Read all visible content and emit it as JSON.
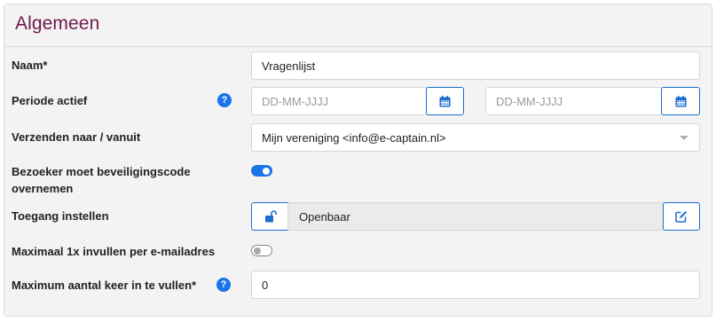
{
  "section": {
    "title": "Algemeen"
  },
  "fields": {
    "naam": {
      "label": "Naam*",
      "value": "Vragenlijst"
    },
    "periode": {
      "label": "Periode actief",
      "start_placeholder": "DD-MM-JJJJ",
      "end_placeholder": "DD-MM-JJJJ"
    },
    "verzenden": {
      "label": "Verzenden naar / vanuit",
      "value": "Mijn vereniging <info@e-captain.nl>"
    },
    "beveiligingscode": {
      "label_line1": "Bezoeker moet beveiligingscode",
      "label_line2": "overnemen",
      "enabled": true
    },
    "toegang": {
      "label": "Toegang instellen",
      "value": "Openbaar"
    },
    "maximaal_1x": {
      "label": "Maximaal 1x invullen per e-mailadres",
      "enabled": false
    },
    "maximum_aantal": {
      "label": "Maximum aantal keer in te vullen*",
      "value": "0"
    }
  },
  "icons": {
    "help": "question-circle-icon",
    "calendar": "calendar-icon",
    "unlock": "unlock-icon",
    "edit": "edit-icon",
    "dropdown": "chevron-down-icon"
  },
  "colors": {
    "title": "#6e1a4d",
    "accent": "#1a73e8",
    "button_border": "#1c6dd0"
  }
}
